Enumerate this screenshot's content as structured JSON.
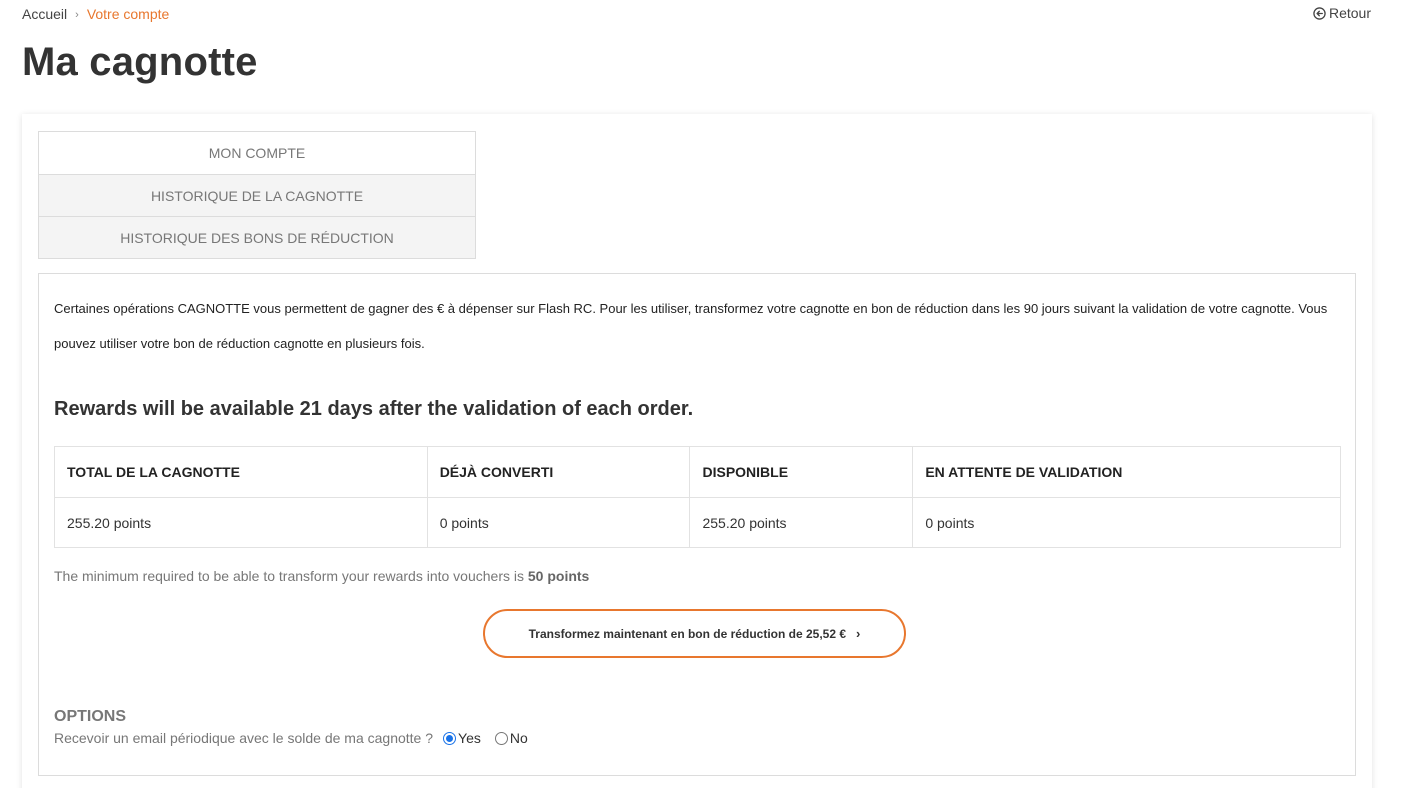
{
  "breadcrumb": {
    "home": "Accueil",
    "separator": "›",
    "current": "Votre compte"
  },
  "back": {
    "label": "Retour",
    "icon": "arrow-left-circle-icon"
  },
  "page_title": "Ma cagnotte",
  "tabs": [
    {
      "label": "MON COMPTE"
    },
    {
      "label": "HISTORIQUE DE LA CAGNOTTE"
    },
    {
      "label": "HISTORIQUE DES BONS DE RÉDUCTION"
    }
  ],
  "intro_text": "Certaines opérations CAGNOTTE vous permettent de gagner des € à dépenser sur Flash RC. Pour les utiliser, transformez votre cagnotte en bon de réduction dans les 90 jours suivant la validation de votre cagnotte. Vous pouvez utiliser votre bon de réduction cagnotte en plusieurs fois.",
  "rewards_note": "Rewards will be available 21 days after the validation of each order.",
  "table": {
    "headers": [
      "TOTAL DE LA CAGNOTTE",
      "DÉJÀ CONVERTI",
      "DISPONIBLE",
      "EN ATTENTE DE VALIDATION"
    ],
    "row": [
      "255.20 points",
      "0 points",
      "255.20 points",
      "0 points"
    ]
  },
  "minimum": {
    "text": "The minimum required to be able to transform your rewards into vouchers is",
    "value": "50 points"
  },
  "convert_button": {
    "label": "Transformez maintenant en bon de réduction de 25,52 €",
    "chevron": "›"
  },
  "options": {
    "title": "OPTIONS",
    "question": "Recevoir un email périodique avec le solde de ma cagnotte ?",
    "choices": [
      {
        "label": "Yes",
        "checked": true
      },
      {
        "label": "No",
        "checked": false
      }
    ]
  },
  "colors": {
    "accent": "#e8772e",
    "radio_selected": "#1a73e8"
  }
}
